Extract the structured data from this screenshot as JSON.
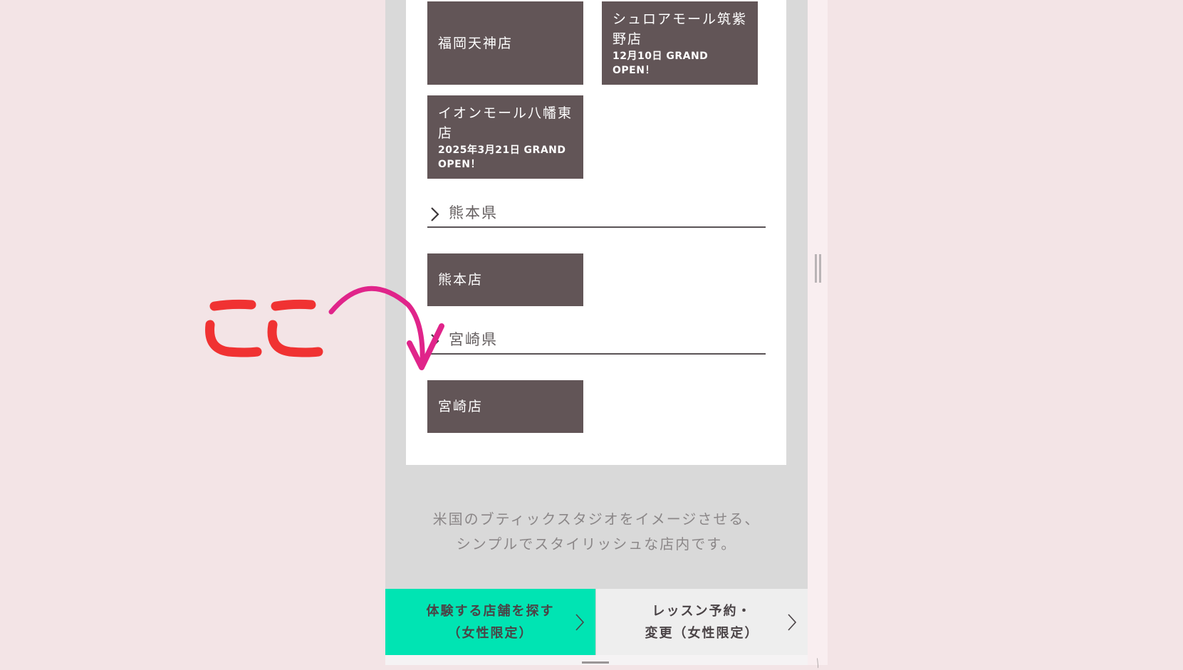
{
  "stores_top": [
    {
      "name": "福岡天神店",
      "note": ""
    },
    {
      "name": "シュロアモール筑紫野店",
      "note": "12月10日 GRAND OPEN！"
    },
    {
      "name": "イオンモール八幡東店",
      "note": "2025年3月21日 GRAND OPEN！"
    }
  ],
  "kumamoto": {
    "prefecture": "熊本県",
    "stores": [
      {
        "name": "熊本店"
      }
    ]
  },
  "miyazaki": {
    "prefecture": "宮崎県",
    "stores": [
      {
        "name": "宮崎店"
      }
    ]
  },
  "description": [
    "米国のブティックスタジオをイメージさせる、",
    "シンプルでスタイリッシュな店内です。"
  ],
  "cta": {
    "find_store": "体験する店舗を探す\n（女性限定）",
    "lesson": "レッスン予約・\n変更（女性限定）"
  },
  "annotation": {
    "label": "ここ",
    "color": "#f03232",
    "arrow_color": "#e0248a"
  },
  "colors": {
    "tile": "#625557",
    "cta_green": "#00e4b3",
    "page_bg": "#f3e4e6"
  }
}
